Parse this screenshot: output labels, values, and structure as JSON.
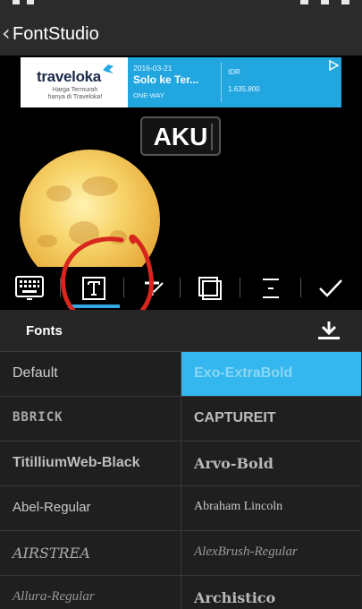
{
  "app": {
    "title": "FontStudio"
  },
  "ad": {
    "brand": "traveloka",
    "tagline": "Harga Termurah hanya di Traveloka!",
    "date": "2016-03-21",
    "route": "Solo ke Ter...",
    "trip_type": "ONE-WAY",
    "currency": "IDR",
    "price": "1.635.800",
    "accent": "#21a6e0"
  },
  "canvas": {
    "text": "AKU"
  },
  "toolbar": {
    "tools": [
      "keyboard-icon",
      "text-style-icon",
      "text-color-icon",
      "shadow-icon",
      "alignment-icon",
      "confirm-check-icon"
    ],
    "active_index": 1,
    "accent": "#33a9e6"
  },
  "fonts_panel": {
    "title": "Fonts",
    "fonts": [
      [
        "Default",
        "Exo-ExtraBold"
      ],
      [
        "BBRICK",
        "CAPTUREIT"
      ],
      [
        "TitilliumWeb-Black",
        "Arvo-Bold"
      ],
      [
        "Abel-Regular",
        "Abraham Lincoln"
      ],
      [
        "AIRSTREA",
        "AlexBrush-Regular"
      ],
      [
        "Allura-Regular",
        "Archistico"
      ]
    ],
    "selected": "Exo-ExtraBold",
    "selected_color": "#33b7ee"
  }
}
